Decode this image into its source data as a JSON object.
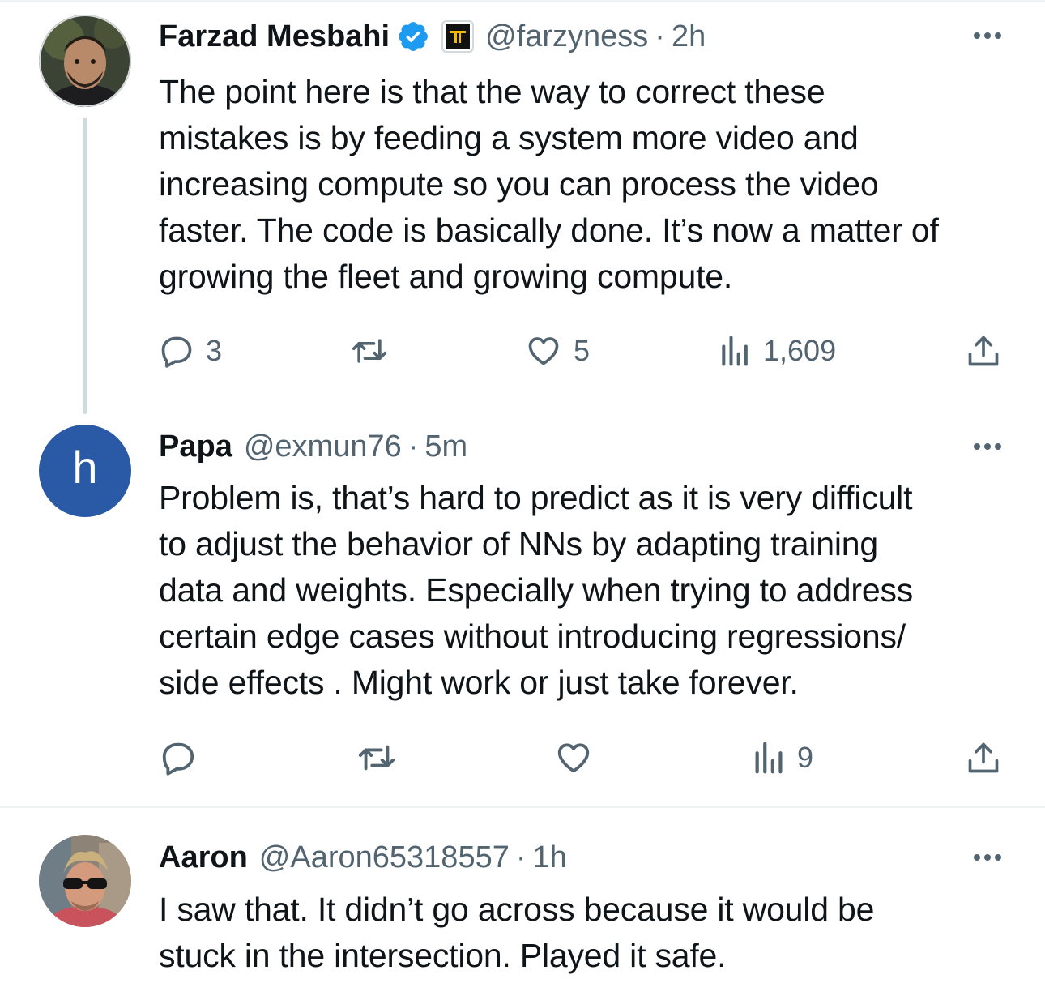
{
  "tweets": [
    {
      "name": "Farzad Mesbahi",
      "handle": "@farzyness",
      "time": "2h",
      "text": "The point here is that the way to correct these\nmistakes is by feeding a system more video and\nincreasing compute so you can process the video\nfaster. The code is basically done. It’s now a matter of\ngrowing the fleet and growing compute.",
      "replies": "3",
      "reposts": "",
      "likes": "5",
      "views": "1,609",
      "verified": true,
      "affiliate_badge": "IT"
    },
    {
      "name": "Papa",
      "handle": "@exmun76",
      "time": "5m",
      "avatar_letter": "h",
      "text": "Problem is, that’s hard to predict as it is very difficult\nto adjust the behavior of NNs by adapting training\ndata and weights. Especially when trying to address\ncertain edge cases without introducing regressions/\nside effects . Might work or just take forever.",
      "replies": "",
      "reposts": "",
      "likes": "",
      "views": "9"
    },
    {
      "name": "Aaron",
      "handle": "@Aaron65318557",
      "time": "1h",
      "text": "I saw that. It didn’t go across because it would be\nstuck in the intersection. Played it safe."
    }
  ],
  "separator": "·",
  "colors": {
    "text": "#0f1419",
    "secondary": "#536471",
    "verified_blue": "#1d9bf0",
    "papa_avatar": "#2a5aa6",
    "thread_line": "#cfd9de"
  }
}
